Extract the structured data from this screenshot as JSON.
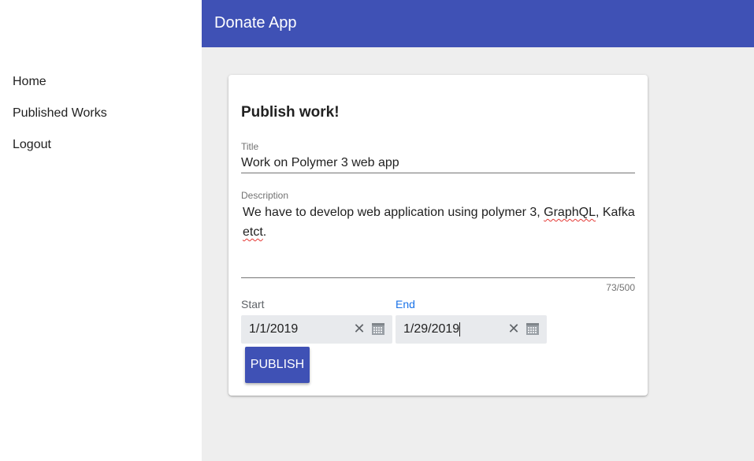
{
  "app": {
    "title": "Donate App"
  },
  "nav": {
    "items": [
      {
        "label": "Home"
      },
      {
        "label": "Published Works"
      },
      {
        "label": "Logout"
      }
    ]
  },
  "form": {
    "heading": "Publish work!",
    "title_label": "Title",
    "title_value": "Work on Polymer 3 web app",
    "description_label": "Description",
    "description_value": "We have to develop web application using polymer 3, GraphQL, Kafka etct.",
    "description_line1_a": "We have to develop web application using polymer 3, ",
    "description_line1_b": "GraphQL",
    "description_line1_c": ", Kafka",
    "description_line2_a": "etct",
    "description_line2_b": ".",
    "char_counter": "73/500",
    "start_label": "Start",
    "start_value": "1/1/2019",
    "end_label": "End",
    "end_value": "1/29/2019",
    "publish_label": "PUBLISH"
  },
  "colors": {
    "primary": "#3f51b5",
    "end_label_active": "#1a73e8",
    "start_label": "#5f6368",
    "content_bg": "#eeeeee"
  },
  "icons": {
    "clear": "close-icon",
    "calendar": "calendar-icon"
  }
}
